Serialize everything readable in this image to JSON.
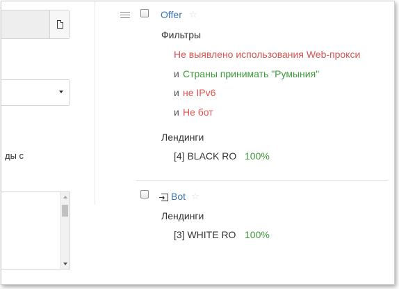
{
  "left_panel": {
    "text_partial": "ды с"
  },
  "rules": [
    {
      "title": "Offer",
      "filters_heading": "Фильтры",
      "filters": [
        {
          "prefix": "",
          "text": "Не выявлено использования Web-прокси",
          "color": "#d9534f"
        },
        {
          "prefix": "и",
          "text": "Страны принимать \"Румыния\"",
          "color": "#3c9a3a"
        },
        {
          "prefix": "и",
          "text": "не IPv6",
          "color": "#d9534f"
        },
        {
          "prefix": "и",
          "text": "Не бот",
          "color": "#d9534f"
        }
      ],
      "landings_heading": "Лендинги",
      "landings": [
        {
          "name": "[4] BLACK RO",
          "percent": "100%"
        }
      ]
    },
    {
      "title": "Bot",
      "landings_heading": "Лендинги",
      "landings": [
        {
          "name": "[3] WHITE RO",
          "percent": "100%"
        }
      ]
    }
  ]
}
